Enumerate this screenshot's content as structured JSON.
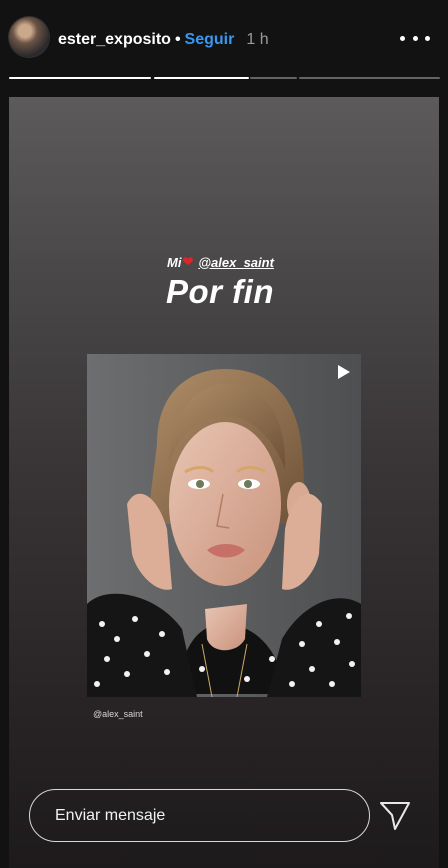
{
  "header": {
    "username": "ester_exposito",
    "separator": "•",
    "follow_label": "Seguir",
    "time": "1 h",
    "more_icon": "more-horizontal-icon",
    "progress_segments": [
      1,
      1,
      0,
      0
    ]
  },
  "story": {
    "caption_prefix": "Mi",
    "heart_icon": "heart-icon",
    "mention": "@alex_saint",
    "headline": "Por fin",
    "photo_credit": "@alex_saint",
    "play_icon": "play-icon"
  },
  "footer": {
    "message_placeholder": "Enviar mensaje",
    "send_icon": "send-icon"
  },
  "colors": {
    "follow": "#3897f0",
    "heart": "#e0242b",
    "background": "#121212"
  }
}
